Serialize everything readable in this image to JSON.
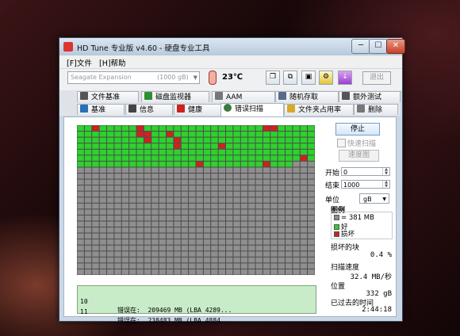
{
  "window": {
    "title": "HD Tune 专业版 v4.60 - 硬盘专业工具"
  },
  "window_buttons": {
    "minimize": "─",
    "maximize": "☐",
    "close": "✕"
  },
  "menu": [
    {
      "label": "[F]文件"
    },
    {
      "label": "[H]帮助"
    }
  ],
  "toolbar": {
    "drive_name": "Seagate Expansion",
    "drive_size": "(1000 gB)",
    "temperature": "23℃",
    "exit_label": "退出",
    "icons": [
      "copy-icon",
      "copy-screen-icon",
      "save-icon",
      "options-icon",
      "download-icon"
    ]
  },
  "tabs_row1": [
    {
      "label": "文件基准",
      "icon": "file-benchmark-icon",
      "color": "#555555"
    },
    {
      "label": "磁盘监视器",
      "icon": "disk-monitor-icon",
      "color": "#2f8f2f"
    },
    {
      "label": "AAM",
      "icon": "speaker-icon",
      "color": "#777777"
    },
    {
      "label": "随机存取",
      "icon": "random-access-icon",
      "color": "#5a6a8a"
    },
    {
      "label": "额外测试",
      "icon": "extra-tests-icon",
      "color": "#555555"
    }
  ],
  "tabs_row2": [
    {
      "label": "基准",
      "icon": "benchmark-icon",
      "color": "#2c6fb5"
    },
    {
      "label": "信息",
      "icon": "info-icon",
      "color": "#444444"
    },
    {
      "label": "健康",
      "icon": "health-icon",
      "color": "#cc2222"
    },
    {
      "label": "错误扫描",
      "icon": "magnifier-icon",
      "color": "#3a7a3a"
    },
    {
      "label": "文件夹占用率",
      "icon": "folder-icon",
      "color": "#d9a92a"
    },
    {
      "label": "删除",
      "icon": "delete-icon",
      "color": "#777777"
    }
  ],
  "scan_map": {
    "cols": 32,
    "rows": 25,
    "scanned_fraction": 0.276,
    "colors": {
      "ok": "#2ed12e",
      "bad": "#cc2222",
      "unscanned": "#8f8f8f",
      "gridline": "#4c4c4c"
    },
    "bad_blocks": [
      [
        2,
        0
      ],
      [
        8,
        0
      ],
      [
        25,
        0
      ],
      [
        26,
        0
      ],
      [
        8,
        1
      ],
      [
        9,
        1
      ],
      [
        12,
        1
      ],
      [
        9,
        2
      ],
      [
        13,
        2
      ],
      [
        13,
        3
      ],
      [
        19,
        3
      ],
      [
        30,
        5
      ],
      [
        25,
        6
      ],
      [
        16,
        6
      ]
    ]
  },
  "log": [
    {
      "block": "10",
      "text": "错误在:  209469 MB (LBA 4289..."
    },
    {
      "block": "11",
      "text": "错误在:  238483 MB (LBA 4884..."
    }
  ],
  "controls": {
    "stop_label": "停止",
    "quick_scan_label": "快速扫描",
    "quick_scan_checked": false,
    "map_button_label": "速度图",
    "start_label": "开始",
    "start_value": "0",
    "end_label": "结束",
    "end_value": "1000",
    "unit_label": "单位",
    "unit_value": "gB"
  },
  "legend": {
    "title": "图例",
    "block_size": "= 381 MB",
    "ok_label": "好",
    "bad_label": "损坏"
  },
  "stats": {
    "damaged_label": "损坏的块",
    "damaged_value": "0.4 %",
    "speed_label": "扫描速度",
    "speed_value": "32.4 MB/秒",
    "position_label": "位置",
    "position_value": "332 gB",
    "elapsed_label": "已过去的时间",
    "elapsed_value": "2:44:18"
  }
}
